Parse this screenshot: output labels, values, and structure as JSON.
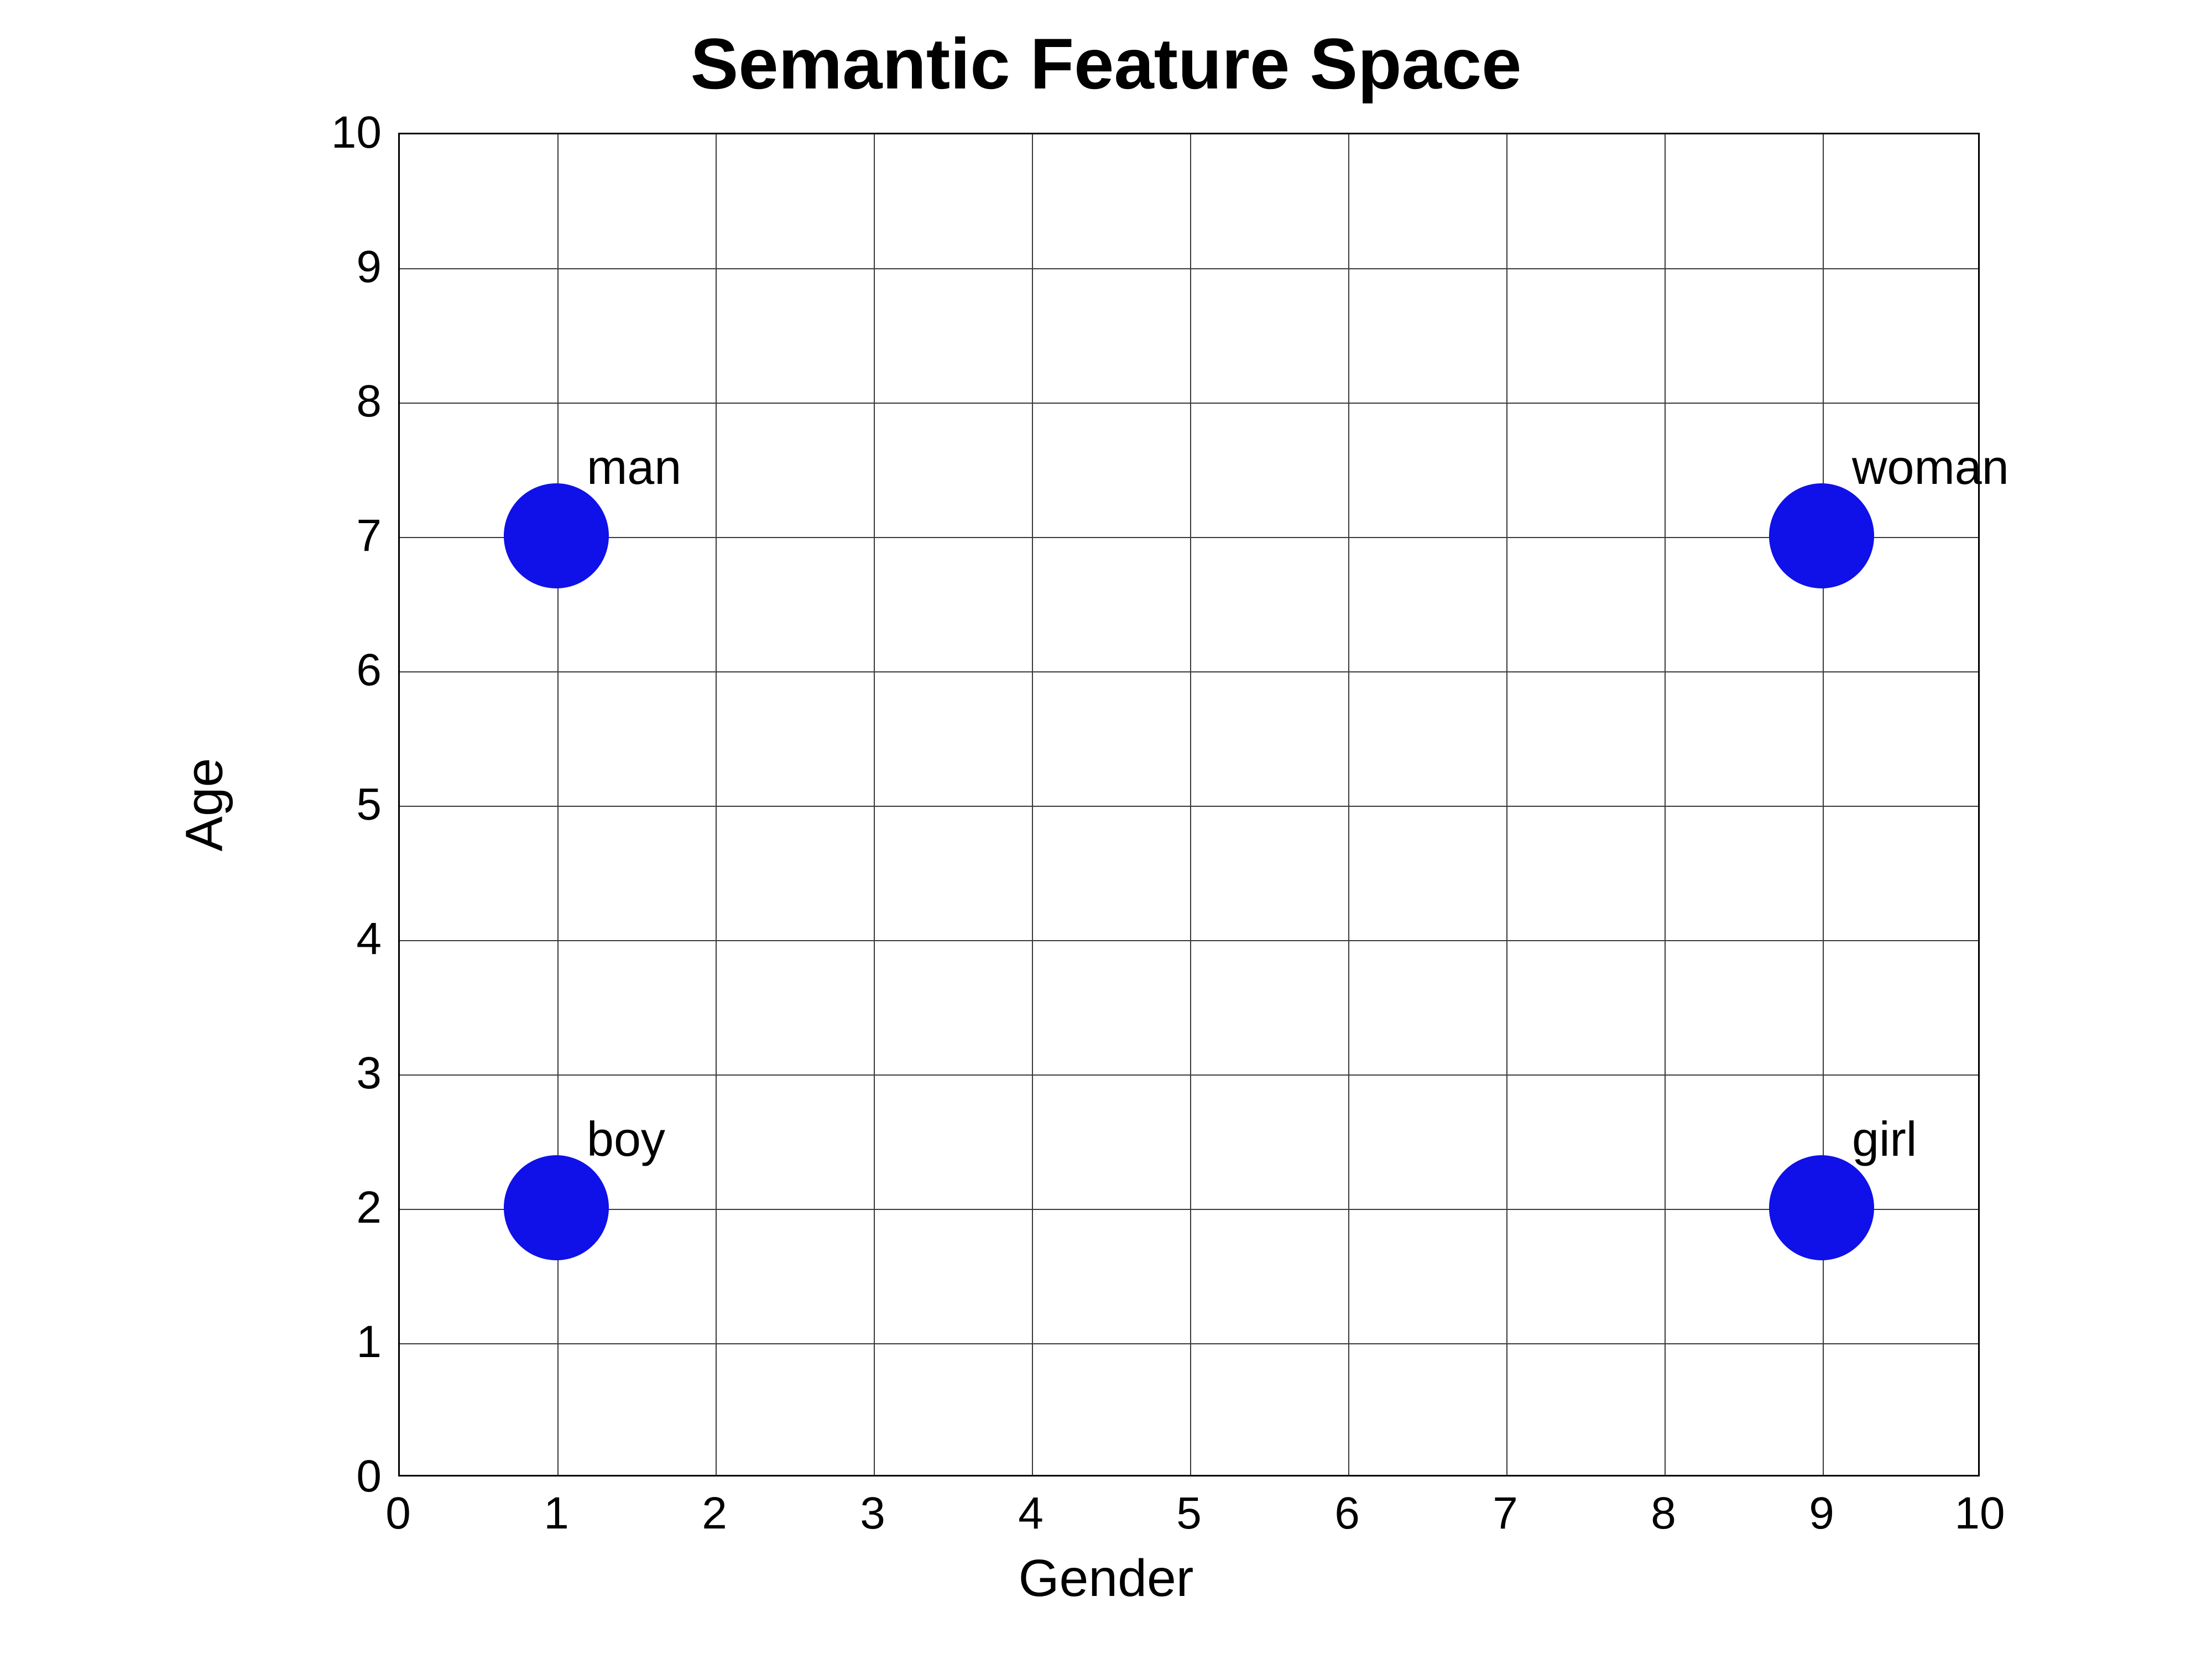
{
  "chart_data": {
    "type": "scatter",
    "title": "Semantic Feature Space",
    "xlabel": "Gender",
    "ylabel": "Age",
    "xlim": [
      0,
      10
    ],
    "ylim": [
      0,
      10
    ],
    "xticks": [
      0,
      1,
      2,
      3,
      4,
      5,
      6,
      7,
      8,
      9,
      10
    ],
    "yticks": [
      0,
      1,
      2,
      3,
      4,
      5,
      6,
      7,
      8,
      9,
      10
    ],
    "grid": true,
    "points": [
      {
        "label": "man",
        "x": 1,
        "y": 7
      },
      {
        "label": "woman",
        "x": 9,
        "y": 7
      },
      {
        "label": "boy",
        "x": 1,
        "y": 2
      },
      {
        "label": "girl",
        "x": 9,
        "y": 2
      }
    ],
    "marker_color": "#1010e8"
  }
}
